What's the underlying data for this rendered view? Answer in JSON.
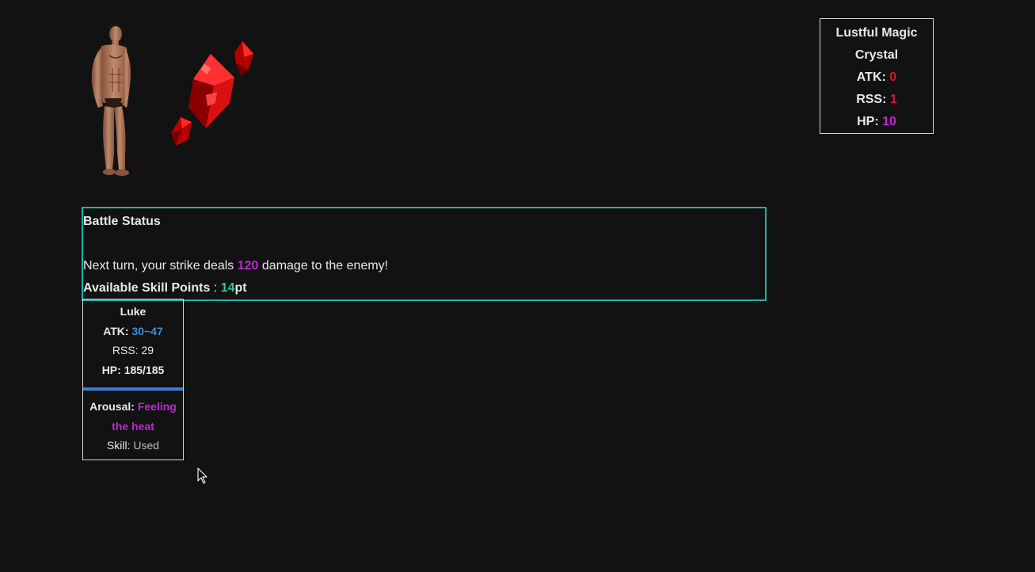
{
  "enemy": {
    "name": "Lustful Magic Crystal",
    "atk_label": "ATK:",
    "atk_value": "0",
    "rss_label": "RSS:",
    "rss_value": "1",
    "hp_label": "HP:",
    "hp_value": "10",
    "sprite_icon": "red-crystal-icon",
    "colors": {
      "stat_red": "#dc143c",
      "stat_magenta": "#c026d3"
    }
  },
  "player": {
    "sprite_icon": "muscular-man-figure"
  },
  "battle_status": {
    "title": "Battle Status",
    "damage_prefix": "Next turn, your strike deals ",
    "damage_value": "120",
    "damage_suffix": " damage to the enemy!",
    "skill_points_label": "Available Skill Points",
    "skill_points_separator": " : ",
    "skill_points_value": "14",
    "skill_points_unit": "pt",
    "border_color": "#20b2aa"
  },
  "player_card": {
    "name": "Luke",
    "atk_label": "ATK: ",
    "atk_value": "30~47",
    "rss_text": "RSS: 29",
    "hp_text": "HP: 185/185",
    "hp_fraction": 1.0,
    "arousal_label": "Arousal: ",
    "arousal_value": "Feeling the heat",
    "skill_label": "Skill: ",
    "skill_value": "Used",
    "colors": {
      "atk": "#3b8fe0",
      "arousal": "#c026d3",
      "hp_bar": "#3b7dd8"
    }
  },
  "cursor_icon": "mouse-pointer-icon"
}
